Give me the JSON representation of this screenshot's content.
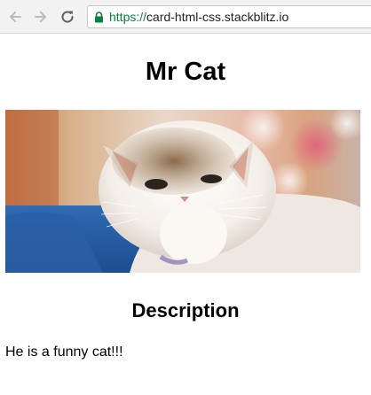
{
  "browser": {
    "url_scheme": "https://",
    "url_host": "card-html-css.stackblitz.io",
    "secure_color": "#0b8043"
  },
  "card": {
    "title": "Mr Cat",
    "image_subject": "cat-photo",
    "description_heading": "Description",
    "description_text": "He is a funny cat!!!"
  }
}
